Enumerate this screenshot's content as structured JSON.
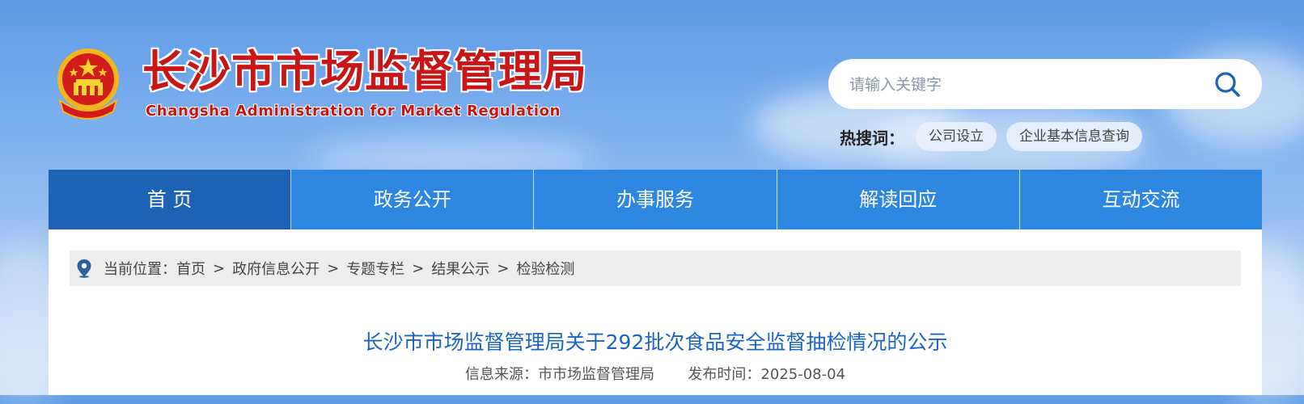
{
  "header": {
    "title": "长沙市市场监督管理局",
    "subtitle": "Changsha Administration for Market Regulation",
    "emblem_icon": "national-emblem-icon"
  },
  "search": {
    "placeholder": "请输入关键字",
    "value": "",
    "icon": "search-icon"
  },
  "hot_search": {
    "label": "热搜词：",
    "tags": [
      "公司设立",
      "企业基本信息查询"
    ]
  },
  "nav": {
    "items": [
      "首 页",
      "政务公开",
      "办事服务",
      "解读回应",
      "互动交流"
    ],
    "active_index": 0
  },
  "breadcrumb": {
    "icon": "location-pin-icon",
    "prefix": "当前位置：",
    "items": [
      "首页",
      "政府信息公开",
      "专题专栏",
      "结果公示",
      "检验检测"
    ],
    "separator": ">"
  },
  "article": {
    "title": "长沙市市场监督管理局关于292批次食品安全监督抽检情况的公示",
    "source_label": "信息来源：",
    "source": "市市场监督管理局",
    "date_label": "发布时间：",
    "date": "2025-08-04"
  },
  "colors": {
    "brand_red": "#c81515",
    "nav_blue": "#2d86e0",
    "nav_active": "#1e62b5",
    "title_blue": "#1b64c5"
  }
}
